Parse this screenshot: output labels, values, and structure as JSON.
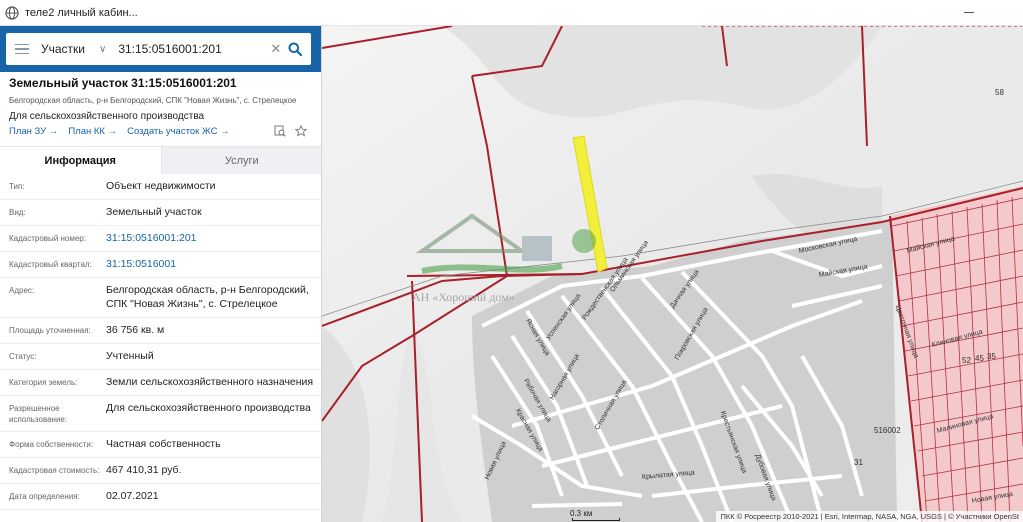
{
  "browser": {
    "tab_title": "теле2 личный кабин..."
  },
  "search": {
    "type": "Участки",
    "value": "31:15:0516001:201"
  },
  "parcel": {
    "title": "Земельный участок 31:15:0516001:201",
    "address_line": "Белгородская область, р-н Белгородский, СПК \"Новая Жизнь\", с. Стрелецкое",
    "purpose": "Для сельскохозяйственного производства",
    "links": [
      "План ЗУ",
      "План КК",
      "Создать участок ЖС"
    ]
  },
  "tabs": {
    "info": "Информация",
    "services": "Услуги"
  },
  "rows": [
    {
      "k": "Тип:",
      "v": "Объект недвижимости"
    },
    {
      "k": "Вид:",
      "v": "Земельный участок"
    },
    {
      "k": "Кадастровый номер:",
      "v": "31:15:0516001:201"
    },
    {
      "k": "Кадастровый квартал:",
      "v": "31:15:0516001"
    },
    {
      "k": "Адрес:",
      "v": "Белгородская область, р-н Белгородский, СПК \"Новая Жизнь\", с. Стрелецкое"
    },
    {
      "k": "Площадь уточненная:",
      "v": "36 756 кв. м"
    },
    {
      "k": "Статус:",
      "v": "Учтенный"
    },
    {
      "k": "Категория земель:",
      "v": "Земли сельскохозяйственного назначения"
    },
    {
      "k": "Разрешенное использование:",
      "v": "Для сельскохозяйственного производства"
    },
    {
      "k": "Форма собственности:",
      "v": "Частная собственность"
    },
    {
      "k": "Кадастровая стоимость:",
      "v": "467 410,31 руб."
    },
    {
      "k": "Дата определения:",
      "v": "02.07.2021"
    }
  ],
  "map": {
    "scale": "0.3 км",
    "attribution": "ПКК © Росреестр 2010-2021 | Esri, Intermap, NASA, NGA, USGS | © Участники OpenSt",
    "watermark": "АН «Хороший дом»",
    "labels": [
      "58",
      "516002",
      "31",
      "52",
      "45",
      "35"
    ],
    "streets": [
      "Московская улица",
      "Майская улица",
      "Ольминская улица",
      "Дачная улица",
      "Рождественская улица",
      "Успенская улица",
      "Ясная улица",
      "Рабочая улица",
      "Красная улица",
      "Нагорная улица",
      "Столичная улица",
      "Покровская улица",
      "Новая улица",
      "Крылатая улица",
      "Крестьянская улица",
      "Дубовая улица",
      "Майская улица",
      "Цветочная улица",
      "Клиновая улица",
      "Малиновая улица",
      "Новая улица"
    ],
    "colors": {
      "boundary": "#a8202a",
      "parcel": "#f2ef3a",
      "residential": "#f3c9cc",
      "urban": "#c9c9c9"
    }
  }
}
